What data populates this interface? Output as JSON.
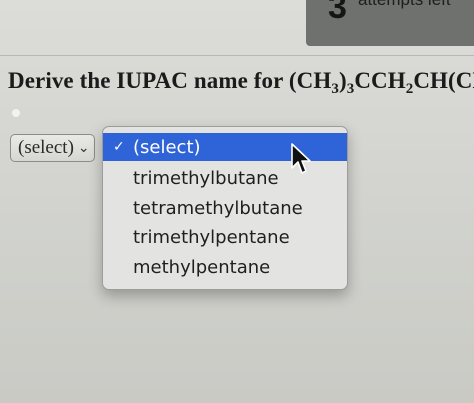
{
  "header": {
    "attempts_number": "3",
    "attempts_text": "attempts left"
  },
  "question": {
    "prefix": "Derive the IUPAC name for (CH",
    "sub1": "3",
    "mid1": ")",
    "sub2": "3",
    "mid2": "CCH",
    "sub3": "2",
    "suffix": "CH(CH"
  },
  "select": {
    "current_value": "(select)"
  },
  "dropdown": {
    "options": [
      "(select)",
      "trimethylbutane",
      "tetramethylbutane",
      "trimethylpentane",
      "methylpentane"
    ],
    "selected_index": 0
  },
  "colors": {
    "highlight": "#2f63d8",
    "attempts_box": "#6f716e",
    "background": "#d3d4cf"
  },
  "icons": {
    "check": "checkmark-icon",
    "chevron": "chevron-down-icon",
    "cursor": "mouse-pointer-icon"
  }
}
